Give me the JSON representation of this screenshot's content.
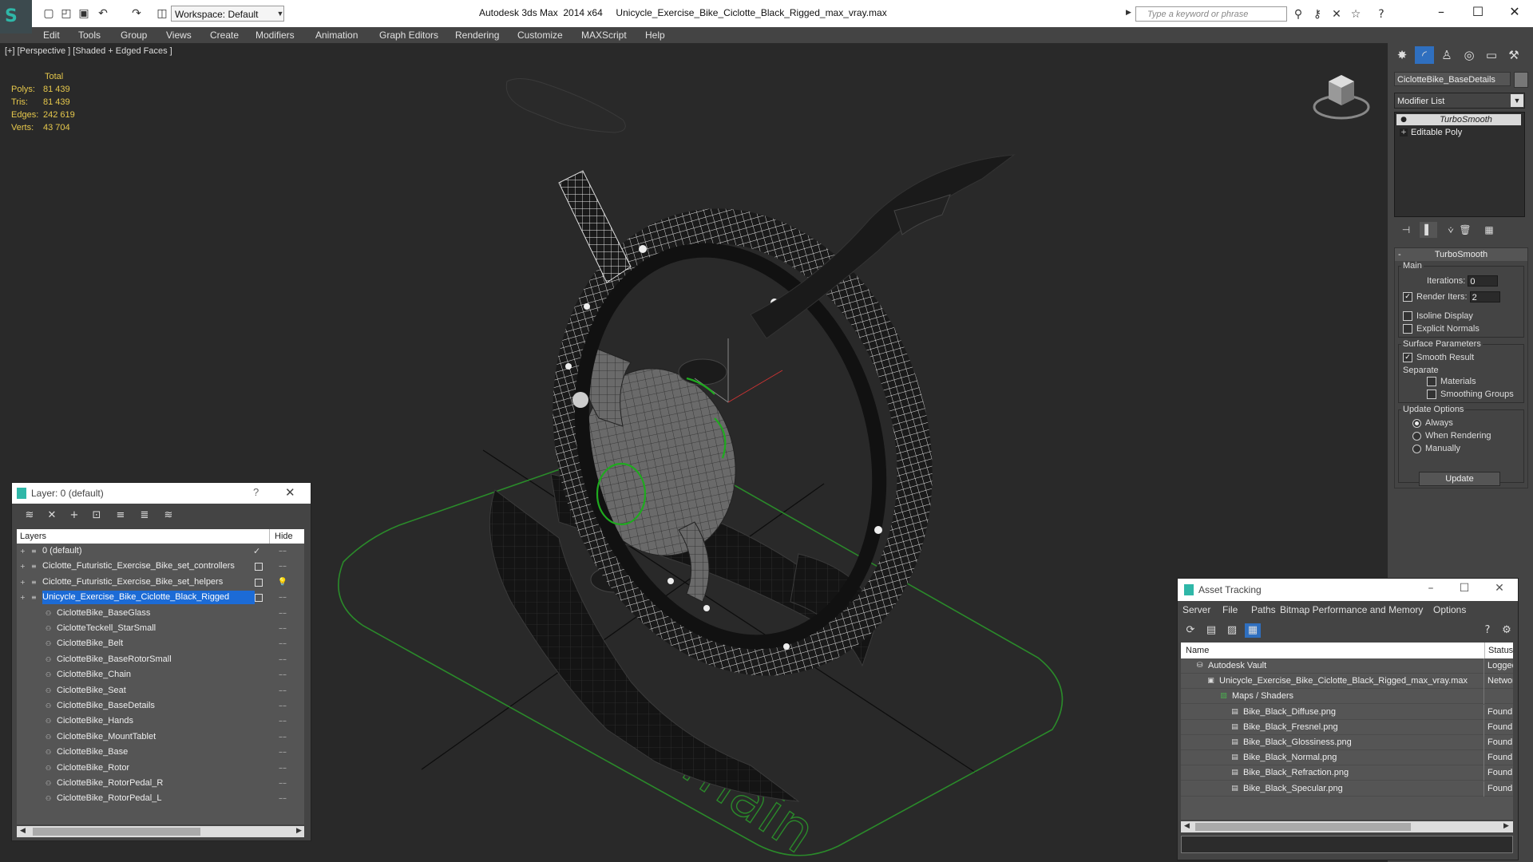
{
  "titlebar": {
    "workspace": "Workspace: Default",
    "title": "Autodesk 3ds Max  2014 x64     Unicycle_Exercise_Bike_Ciclotte_Black_Rigged_max_vray.max",
    "search_placeholder": "Type a keyword or phrase"
  },
  "menu": [
    "Edit",
    "Tools",
    "Group",
    "Views",
    "Create",
    "Modifiers",
    "Animation",
    "Graph Editors",
    "Rendering",
    "Customize",
    "MAXScript",
    "Help"
  ],
  "viewport": {
    "label": "[+] [Perspective ] [Shaded + Edged Faces ]",
    "watermark": "main",
    "stats": {
      "header": "Total",
      "rows": [
        {
          "label": "Polys:",
          "value": "81 439"
        },
        {
          "label": "Tris:",
          "value": "81 439"
        },
        {
          "label": "Edges:",
          "value": "242 619"
        },
        {
          "label": "Verts:",
          "value": "43 704"
        }
      ]
    }
  },
  "command_panel": {
    "object_name": "CiclotteBike_BaseDetails",
    "modifier_list": "Modifier List",
    "stack": [
      "TurboSmooth",
      "Editable Poly"
    ],
    "rollout": {
      "title": "TurboSmooth",
      "main_group": "Main",
      "iterations_label": "Iterations:",
      "iterations_value": "0",
      "render_iters_label": "Render Iters:",
      "render_iters_value": "2",
      "isoline": "Isoline Display",
      "explicit_normals": "Explicit Normals",
      "surface_group": "Surface Parameters",
      "smooth_result": "Smooth Result",
      "separate": "Separate",
      "materials": "Materials",
      "smoothing_groups": "Smoothing Groups",
      "update_group": "Update Options",
      "always": "Always",
      "when_rendering": "When Rendering",
      "manually": "Manually",
      "update_button": "Update"
    }
  },
  "layer_dialog": {
    "title": "Layer: 0 (default)",
    "help": "?",
    "col_layers": "Layers",
    "col_hide": "Hide",
    "rows": [
      {
        "name": "0 (default)"
      },
      {
        "name": "Ciclotte_Futuristic_Exercise_Bike_set_controllers"
      },
      {
        "name": "Ciclotte_Futuristic_Exercise_Bike_set_helpers"
      },
      {
        "name": "Unicycle_Exercise_Bike_Ciclotte_Black_Rigged"
      },
      {
        "name": "CiclotteBike_BaseGlass"
      },
      {
        "name": "CiclotteTeckell_StarSmall"
      },
      {
        "name": "CiclotteBike_Belt"
      },
      {
        "name": "CiclotteBike_BaseRotorSmall"
      },
      {
        "name": "CiclotteBike_Chain"
      },
      {
        "name": "CiclotteBike_Seat"
      },
      {
        "name": "CiclotteBike_BaseDetails"
      },
      {
        "name": "CiclotteBike_Hands"
      },
      {
        "name": "CiclotteBike_MountTablet"
      },
      {
        "name": "CiclotteBike_Base"
      },
      {
        "name": "CiclotteBike_Rotor"
      },
      {
        "name": "CiclotteBike_RotorPedal_R"
      },
      {
        "name": "CiclotteBike_RotorPedal_L"
      }
    ]
  },
  "asset_dialog": {
    "title": "Asset Tracking",
    "menu": [
      "Server",
      "File",
      "Paths",
      "Bitmap Performance and Memory",
      "Options"
    ],
    "col_name": "Name",
    "col_status": "Status",
    "rows": [
      {
        "name": "Autodesk Vault",
        "status": "Logged"
      },
      {
        "name": "Unicycle_Exercise_Bike_Ciclotte_Black_Rigged_max_vray.max",
        "status": "Networ"
      },
      {
        "name": "Maps / Shaders",
        "status": ""
      },
      {
        "name": "Bike_Black_Diffuse.png",
        "status": "Found"
      },
      {
        "name": "Bike_Black_Fresnel.png",
        "status": "Found"
      },
      {
        "name": "Bike_Black_Glossiness.png",
        "status": "Found"
      },
      {
        "name": "Bike_Black_Normal.png",
        "status": "Found"
      },
      {
        "name": "Bike_Black_Refraction.png",
        "status": "Found"
      },
      {
        "name": "Bike_Black_Specular.png",
        "status": "Found"
      }
    ]
  },
  "colors": {
    "accent": "#2fb7a8",
    "selection": "#1c6bd6",
    "stats": "#e6c84c",
    "viewport_bg": "#292929",
    "ground_green": "#2a8a2a"
  }
}
